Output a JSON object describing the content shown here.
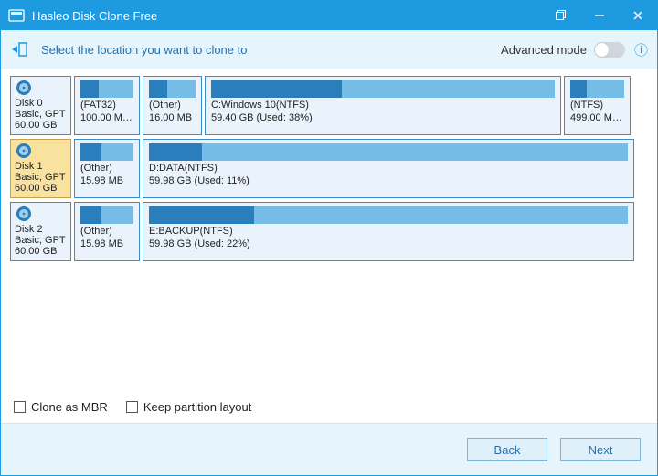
{
  "titlebar": {
    "title": "Hasleo Disk Clone Free"
  },
  "subheader": {
    "text": "Select the location you want to clone to",
    "advanced_label": "Advanced mode",
    "advanced_on": false
  },
  "disks": [
    {
      "id": "disk0",
      "name": "Disk 0",
      "sub1": "Basic, GPT",
      "sub2": "60.00 GB",
      "selected": false,
      "partitions": [
        {
          "label1": "(FAT32)",
          "label2": "100.00 MB ...",
          "fill_pct": 35,
          "flex": 72
        },
        {
          "label1": "(Other)",
          "label2": "16.00 MB",
          "fill_pct": 40,
          "flex": 65
        },
        {
          "label1": "C:Windows 10(NTFS)",
          "label2": "59.40 GB (Used: 38%)",
          "fill_pct": 38,
          "flex": 390
        },
        {
          "label1": "(NTFS)",
          "label2": "499.00 MB ...",
          "fill_pct": 30,
          "flex": 73
        }
      ]
    },
    {
      "id": "disk1",
      "name": "Disk 1",
      "sub1": "Basic, GPT",
      "sub2": "60.00 GB",
      "selected": true,
      "partitions": [
        {
          "label1": "(Other)",
          "label2": "15.98 MB",
          "fill_pct": 40,
          "flex": 72
        },
        {
          "label1": "D:DATA(NTFS)",
          "label2": "59.98 GB (Used: 11%)",
          "fill_pct": 11,
          "flex": 538
        }
      ]
    },
    {
      "id": "disk2",
      "name": "Disk 2",
      "sub1": "Basic, GPT",
      "sub2": "60.00 GB",
      "selected": false,
      "partitions": [
        {
          "label1": "(Other)",
          "label2": "15.98 MB",
          "fill_pct": 40,
          "flex": 72
        },
        {
          "label1": "E:BACKUP(NTFS)",
          "label2": "59.98 GB (Used: 22%)",
          "fill_pct": 22,
          "flex": 538
        }
      ]
    }
  ],
  "options": {
    "clone_as_mbr": "Clone as MBR",
    "keep_layout": "Keep partition layout"
  },
  "footer": {
    "back": "Back",
    "next": "Next"
  }
}
